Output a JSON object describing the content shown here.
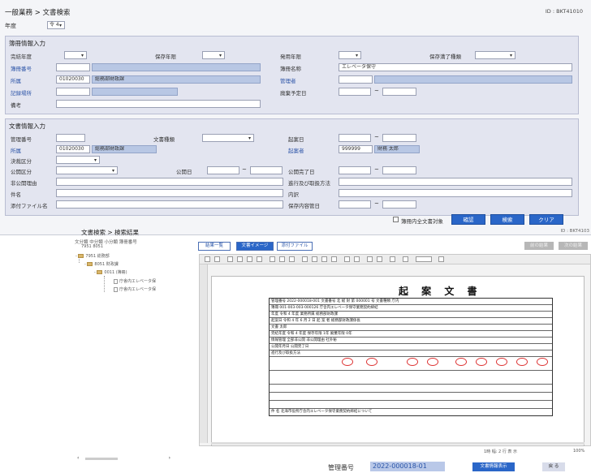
{
  "search": {
    "breadcrumb": "一般業務 > 文書検索",
    "screen_id": "ID : BKT41010",
    "nendo_label": "年度",
    "nendo_value": "令 4",
    "ledger": {
      "title": "簿冊情報入力",
      "kanketsu_nendo_label": "完結年度",
      "hozon_kigen_label": "保存年限",
      "shiyo_nendo_label": "発用年限",
      "hozon_manryo_label": "保存満了種類",
      "bosatsu_no_label": "簿冊番号",
      "bosatsu_name_label": "簿冊名称",
      "bosatsu_name_value": "エレベータ保守",
      "shozoku_label": "所属",
      "shozoku_code": "01020030",
      "shozoku_name": "総務部財政課",
      "kanrisha_label": "管理者",
      "kisai_label": "記録場所",
      "haiki_label": "廃棄予定日",
      "biko_label": "備考"
    },
    "document": {
      "title": "文書情報入力",
      "kanri_no_label": "管理番号",
      "bunsho_shubetsu_label": "文書種類",
      "kian_bi_label": "起案日",
      "shozoku_label": "所属",
      "shozoku_code": "01020030",
      "shozoku_name": "総務部財政課",
      "kiansha_label": "起案者",
      "kiansha_code": "999999",
      "kiansha_name": "財務 太郎",
      "kessai_label": "決裁区分",
      "kokai_kubun_label": "公開区分",
      "kokai_bi_label": "公開日",
      "kokai_kanryo_label": "公開完了日",
      "hikokai_label": "非公開理由",
      "shinko_label": "進行及び取扱方法",
      "kenmei_label": "件名",
      "naiyo_label": "内訳",
      "tenpu_label": "添付ファイル名",
      "hozon_bi_label": "保存内容管日"
    },
    "option_label": "簿冊内全文書対象",
    "buttons": {
      "kakunin": "確認",
      "kensaku": "検索",
      "clear": "クリア"
    }
  },
  "result": {
    "title": "文書検索 > 検索結果",
    "screen_id": "ID : BKT4103",
    "tree_header": "文分類 中分類 小分類 簿冊番号",
    "tree_header_sub": "7951  8051",
    "tree_nodes": [
      "7951 総務部",
      "8051 財政課",
      "0011 (簿冊)",
      "庁舎内エレベータ保",
      "庁舎内エレベータ保"
    ],
    "tabs": {
      "kekka_ichiran": "結果一覧",
      "bunsho_image": "文書イメージ",
      "tenpu_file": "添付ファイル"
    },
    "gray_buttons": [
      "前の結果",
      "次の結果"
    ],
    "document": {
      "title": "起 案 文 書",
      "rows": [
        "管理番号 2022-000018-001  文書番号 北 総 財   第 000001 号  文書種類 庁内",
        "簿冊 001-003-003-000126 庁舎内エレベータ保守業務契約締結",
        "年度   令和 4 年度         業務所属  総務部財政課",
        "起案日  令和 4 年 6 月 2 日    起 案 者  総務部財政課係長",
        "                             文書 太郎",
        "完結年度  令和 4 年度   保存年限 1年         廃棄年限  0年",
        "情報管理  全部非公開   非公開理由 社外秘",
        "公開年月日                    公開完了日",
        "進行及び取扱方法",
        "",
        "",
        "",
        "",
        "",
        "件  名   北海市役所庁舎内エレベータ保守業務契約締結について"
      ]
    },
    "viewer_status": [
      "1時 幅: 2 行 表 示",
      "100%"
    ],
    "kanri_label": "管理番号",
    "kanri_value": "2022-000018-01",
    "mgmt_button": "文書情報表示",
    "back_button": "戻 る"
  }
}
